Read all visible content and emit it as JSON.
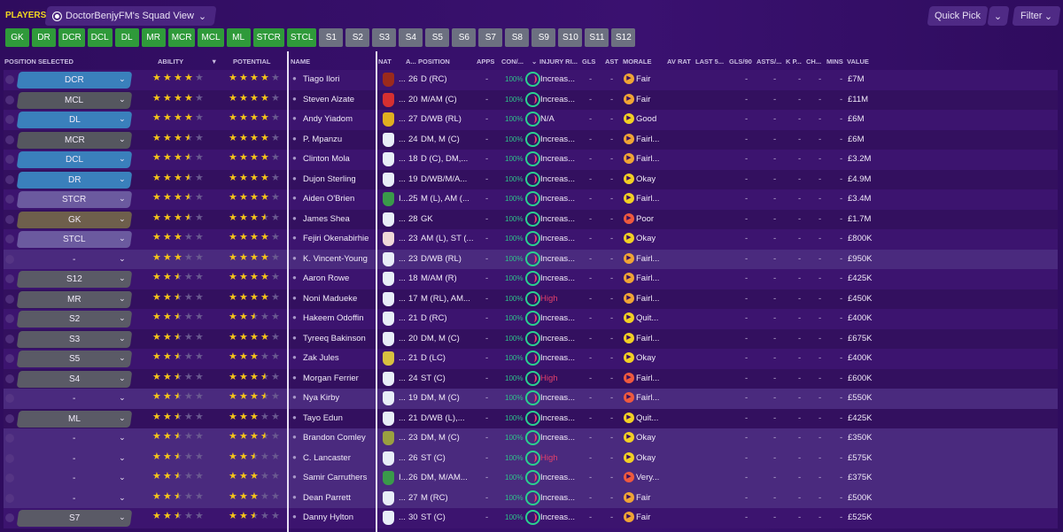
{
  "header": {
    "section": "PLAYERS",
    "view_label": "DoctorBenjyFM's Squad View",
    "quick_pick": "Quick Pick",
    "filter": "Filter"
  },
  "tabs": [
    {
      "label": "GK",
      "type": "g"
    },
    {
      "label": "DR",
      "type": "g"
    },
    {
      "label": "DCR",
      "type": "g"
    },
    {
      "label": "DCL",
      "type": "g"
    },
    {
      "label": "DL",
      "type": "g"
    },
    {
      "label": "MR",
      "type": "g"
    },
    {
      "label": "MCR",
      "type": "g"
    },
    {
      "label": "MCL",
      "type": "g"
    },
    {
      "label": "ML",
      "type": "g"
    },
    {
      "label": "STCR",
      "type": "g"
    },
    {
      "label": "STCL",
      "type": "g"
    },
    {
      "label": "S1",
      "type": "s"
    },
    {
      "label": "S2",
      "type": "s"
    },
    {
      "label": "S3",
      "type": "s"
    },
    {
      "label": "S4",
      "type": "s"
    },
    {
      "label": "S5",
      "type": "s"
    },
    {
      "label": "S6",
      "type": "s"
    },
    {
      "label": "S7",
      "type": "s"
    },
    {
      "label": "S8",
      "type": "s"
    },
    {
      "label": "S9",
      "type": "s"
    },
    {
      "label": "S10",
      "type": "s"
    },
    {
      "label": "S11",
      "type": "s"
    },
    {
      "label": "S12",
      "type": "s"
    }
  ],
  "columns": {
    "position_selected": "POSITION SELECTED",
    "ability": "ABILITY",
    "potential": "POTENTIAL",
    "name": "NAME",
    "nat": "NAT",
    "age": "A...",
    "position": "POSITION",
    "apps": "APPS",
    "con": "CON/...",
    "injury": "INJURY RI...",
    "gls": "GLS",
    "ast": "AST",
    "morale": "MORALE",
    "av_rat": "AV RAT",
    "last5": "LAST 5...",
    "gls90": "GLS/90",
    "asts": "ASTS/...",
    "kp": "K P...",
    "ch": "CH...",
    "mins": "MINS",
    "value": "VALUE"
  },
  "colors": {
    "defence": "#3a80bc",
    "midfield": "#55575f",
    "attack": "#6b5a9f",
    "goalkeeper": "#6e5f4c",
    "sub": "#5a5a66",
    "morale_fair": "#f0a535",
    "morale_good": "#f3d024",
    "morale_poor": "#ef5a3e",
    "injury_high": "#e2406a"
  },
  "rows": [
    {
      "sel": "DCR",
      "grp": "defence",
      "ab": 4,
      "po": 4,
      "name": "Tiago Ilori",
      "flag": "#9b2a1c",
      "nat": "...",
      "age": "26",
      "pos": "D (RC)",
      "apps": "-",
      "con": "100%",
      "inj": "Increas...",
      "gls": "-",
      "ast": "-",
      "morale": "Fair",
      "mc": "morale_fair",
      "value": "£7M"
    },
    {
      "sel": "MCL",
      "grp": "midfield",
      "ab": 4,
      "po": 4,
      "name": "Steven Alzate",
      "flag": "#d63030",
      "nat": "...",
      "age": "20",
      "pos": "M/AM (C)",
      "apps": "-",
      "con": "100%",
      "inj": "Increas...",
      "gls": "-",
      "ast": "-",
      "morale": "Fair",
      "mc": "morale_fair",
      "value": "£11M"
    },
    {
      "sel": "DL",
      "grp": "defence",
      "ab": 4,
      "po": 4,
      "name": "Andy Yiadom",
      "flag": "#e0b020",
      "nat": "...",
      "age": "27",
      "pos": "D/WB (RL)",
      "apps": "-",
      "con": "100%",
      "inj": "N/A",
      "gls": "-",
      "ast": "-",
      "morale": "Good",
      "mc": "morale_good",
      "value": "£6M"
    },
    {
      "sel": "MCR",
      "grp": "midfield",
      "ab": 3.5,
      "po": 4,
      "name": "P. Mpanzu",
      "flag": "#e8eef8",
      "nat": "...",
      "age": "24",
      "pos": "DM, M (C)",
      "apps": "-",
      "con": "100%",
      "inj": "Increas...",
      "gls": "-",
      "ast": "-",
      "morale": "Fairl...",
      "mc": "morale_fair",
      "value": "£6M"
    },
    {
      "sel": "DCL",
      "grp": "defence",
      "ab": 3.5,
      "po": 4,
      "name": "Clinton Mola",
      "flag": "#e8eef8",
      "nat": "...",
      "age": "18",
      "pos": "D (C), DM,...",
      "apps": "-",
      "con": "100%",
      "inj": "Increas...",
      "gls": "-",
      "ast": "-",
      "morale": "Fairl...",
      "mc": "morale_fair",
      "value": "£3.2M"
    },
    {
      "sel": "DR",
      "grp": "defence",
      "ab": 3.5,
      "po": 4,
      "name": "Dujon Sterling",
      "flag": "#e8eef8",
      "nat": "...",
      "age": "19",
      "pos": "D/WB/M/A...",
      "apps": "-",
      "con": "100%",
      "inj": "Increas...",
      "gls": "-",
      "ast": "-",
      "morale": "Okay",
      "mc": "morale_good",
      "value": "£4.9M"
    },
    {
      "sel": "STCR",
      "grp": "attack",
      "ab": 3.5,
      "po": 4,
      "name": "Aiden O'Brien",
      "flag": "#3a9a4a",
      "nat": "I...",
      "age": "25",
      "pos": "M (L), AM (...",
      "apps": "-",
      "con": "100%",
      "inj": "Increas...",
      "gls": "-",
      "ast": "-",
      "morale": "Fairl...",
      "mc": "morale_good",
      "value": "£3.4M"
    },
    {
      "sel": "GK",
      "grp": "goalkeeper",
      "ab": 3.5,
      "po": 3.5,
      "name": "James Shea",
      "flag": "#e8eef8",
      "nat": "...",
      "age": "28",
      "pos": "GK",
      "apps": "-",
      "con": "100%",
      "inj": "Increas...",
      "gls": "-",
      "ast": "-",
      "morale": "Poor",
      "mc": "morale_poor",
      "value": "£1.7M"
    },
    {
      "sel": "STCL",
      "grp": "attack",
      "ab": 3,
      "po": 4,
      "name": "Fejiri Okenabirhie",
      "flag": "#f0d8d8",
      "nat": "...",
      "age": "23",
      "pos": "AM (L), ST (...",
      "apps": "-",
      "con": "100%",
      "inj": "Increas...",
      "gls": "-",
      "ast": "-",
      "morale": "Okay",
      "mc": "morale_good",
      "value": "£800K"
    },
    {
      "sel": "-",
      "grp": "none",
      "ab": 3,
      "po": 4,
      "name": "K. Vincent-Young",
      "flag": "#e8eef8",
      "nat": "...",
      "age": "23",
      "pos": "D/WB (RL)",
      "apps": "-",
      "con": "100%",
      "inj": "Increas...",
      "gls": "-",
      "ast": "-",
      "morale": "Fairl...",
      "mc": "morale_fair",
      "value": "£950K"
    },
    {
      "sel": "S12",
      "grp": "sub",
      "ab": 2.5,
      "po": 4,
      "name": "Aaron Rowe",
      "flag": "#e8eef8",
      "nat": "...",
      "age": "18",
      "pos": "M/AM (R)",
      "apps": "-",
      "con": "100%",
      "inj": "Increas...",
      "gls": "-",
      "ast": "-",
      "morale": "Fairl...",
      "mc": "morale_fair",
      "value": "£425K"
    },
    {
      "sel": "MR",
      "grp": "sub",
      "ab": 2.5,
      "po": 4,
      "name": "Noni Madueke",
      "flag": "#e8eef8",
      "nat": "...",
      "age": "17",
      "pos": "M (RL), AM...",
      "apps": "-",
      "con": "100%",
      "inj": "High",
      "gls": "-",
      "ast": "-",
      "morale": "Fairl...",
      "mc": "morale_fair",
      "value": "£450K"
    },
    {
      "sel": "S2",
      "grp": "sub",
      "ab": 2.5,
      "po": 2.5,
      "name": "Hakeem Odoffin",
      "flag": "#e8eef8",
      "nat": "...",
      "age": "21",
      "pos": "D (RC)",
      "apps": "-",
      "con": "100%",
      "inj": "Increas...",
      "gls": "-",
      "ast": "-",
      "morale": "Quit...",
      "mc": "morale_good",
      "value": "£400K"
    },
    {
      "sel": "S3",
      "grp": "sub",
      "ab": 2.5,
      "po": 4,
      "name": "Tyreeq Bakinson",
      "flag": "#e8eef8",
      "nat": "...",
      "age": "20",
      "pos": "DM, M (C)",
      "apps": "-",
      "con": "100%",
      "inj": "Increas...",
      "gls": "-",
      "ast": "-",
      "morale": "Fairl...",
      "mc": "morale_good",
      "value": "£675K"
    },
    {
      "sel": "S5",
      "grp": "sub",
      "ab": 2.5,
      "po": 3,
      "name": "Zak Jules",
      "flag": "#d8c040",
      "nat": "...",
      "age": "21",
      "pos": "D (LC)",
      "apps": "-",
      "con": "100%",
      "inj": "Increas...",
      "gls": "-",
      "ast": "-",
      "morale": "Okay",
      "mc": "morale_good",
      "value": "£400K"
    },
    {
      "sel": "S4",
      "grp": "sub",
      "ab": 2.5,
      "po": 3.5,
      "name": "Morgan Ferrier",
      "flag": "#e8eef8",
      "nat": "...",
      "age": "24",
      "pos": "ST (C)",
      "apps": "-",
      "con": "100%",
      "inj": "High",
      "gls": "-",
      "ast": "-",
      "morale": "Fairl...",
      "mc": "morale_poor",
      "value": "£600K"
    },
    {
      "sel": "-",
      "grp": "none",
      "ab": 2.5,
      "po": 3.5,
      "name": "Nya Kirby",
      "flag": "#e8eef8",
      "nat": "...",
      "age": "19",
      "pos": "DM, M (C)",
      "apps": "-",
      "con": "100%",
      "inj": "Increas...",
      "gls": "-",
      "ast": "-",
      "morale": "Fairl...",
      "mc": "morale_poor",
      "value": "£550K"
    },
    {
      "sel": "ML",
      "grp": "sub",
      "ab": 2.5,
      "po": 3,
      "name": "Tayo Edun",
      "flag": "#e8eef8",
      "nat": "...",
      "age": "21",
      "pos": "D/WB (L),...",
      "apps": "-",
      "con": "100%",
      "inj": "Increas...",
      "gls": "-",
      "ast": "-",
      "morale": "Quit...",
      "mc": "morale_good",
      "value": "£425K"
    },
    {
      "sel": "-",
      "grp": "none",
      "ab": 2.5,
      "po": 3.5,
      "name": "Brandon Comley",
      "flag": "#9aa040",
      "nat": "...",
      "age": "23",
      "pos": "DM, M (C)",
      "apps": "-",
      "con": "100%",
      "inj": "Increas...",
      "gls": "-",
      "ast": "-",
      "morale": "Okay",
      "mc": "morale_good",
      "value": "£350K"
    },
    {
      "sel": "-",
      "grp": "none",
      "ab": 2.5,
      "po": 2.5,
      "name": "C. Lancaster",
      "flag": "#e8eef8",
      "nat": "...",
      "age": "26",
      "pos": "ST (C)",
      "apps": "-",
      "con": "100%",
      "inj": "High",
      "gls": "-",
      "ast": "-",
      "morale": "Okay",
      "mc": "morale_good",
      "value": "£575K"
    },
    {
      "sel": "-",
      "grp": "none",
      "ab": 2.5,
      "po": 3,
      "name": "Samir Carruthers",
      "flag": "#3a9a4a",
      "nat": "I...",
      "age": "26",
      "pos": "DM, M/AM...",
      "apps": "-",
      "con": "100%",
      "inj": "Increas...",
      "gls": "-",
      "ast": "-",
      "morale": "Very...",
      "mc": "morale_poor",
      "value": "£375K"
    },
    {
      "sel": "-",
      "grp": "none",
      "ab": 2.5,
      "po": 3,
      "name": "Dean Parrett",
      "flag": "#e8eef8",
      "nat": "...",
      "age": "27",
      "pos": "M (RC)",
      "apps": "-",
      "con": "100%",
      "inj": "Increas...",
      "gls": "-",
      "ast": "-",
      "morale": "Fair",
      "mc": "morale_fair",
      "value": "£500K"
    },
    {
      "sel": "S7",
      "grp": "sub",
      "ab": 2.5,
      "po": 2.5,
      "name": "Danny Hylton",
      "flag": "#e8eef8",
      "nat": "...",
      "age": "30",
      "pos": "ST (C)",
      "apps": "-",
      "con": "100%",
      "inj": "Increas...",
      "gls": "-",
      "ast": "-",
      "morale": "Fair",
      "mc": "morale_fair",
      "value": "£525K"
    }
  ]
}
